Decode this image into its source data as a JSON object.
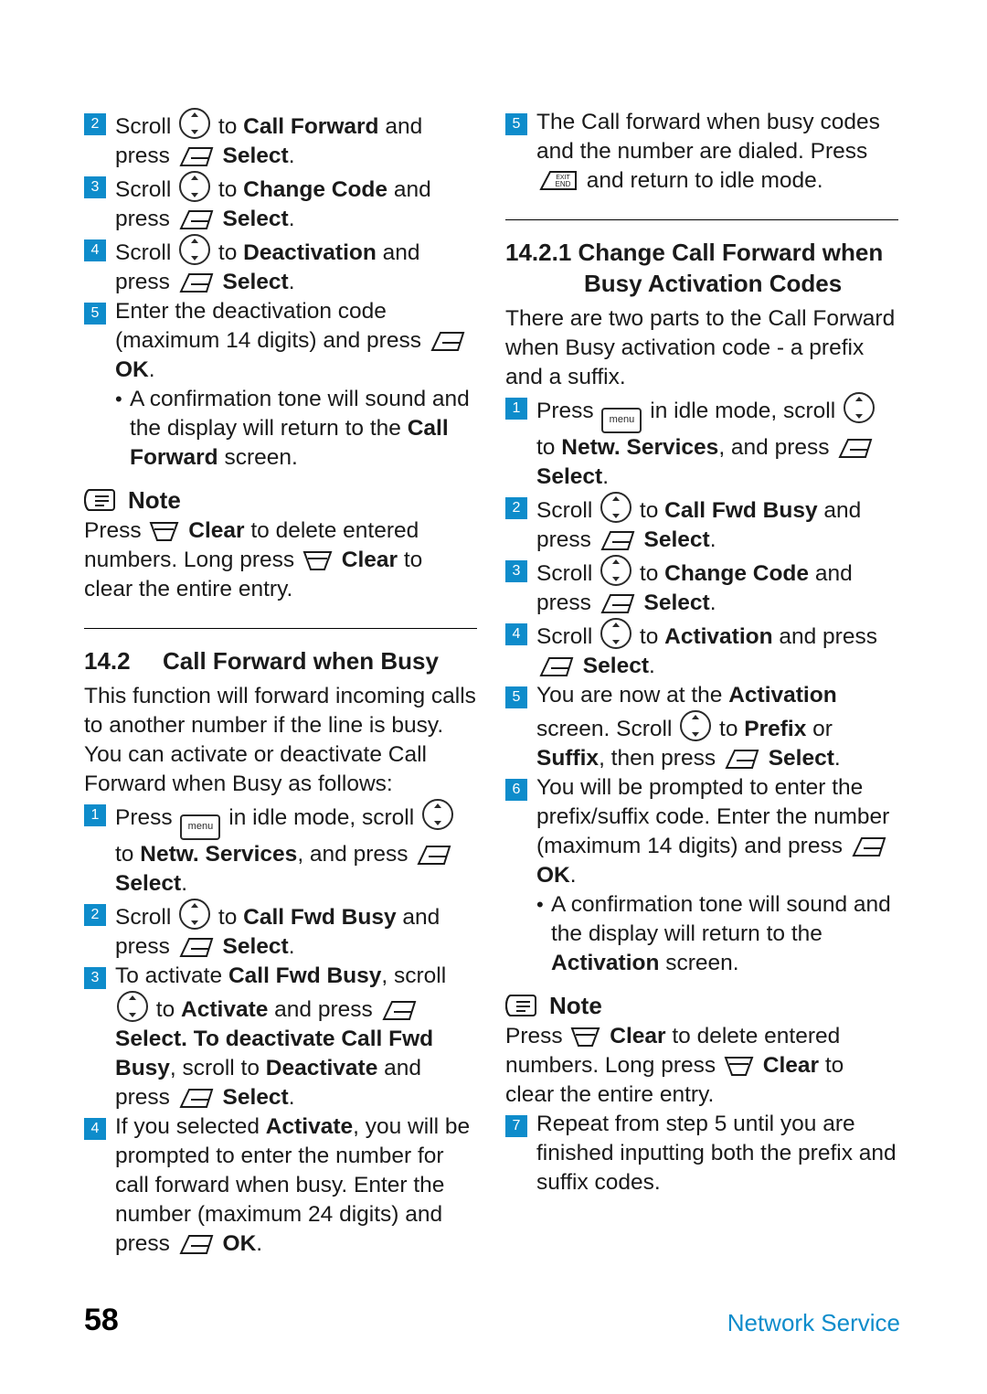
{
  "page": {
    "number": "58",
    "footer_right": "Network Service"
  },
  "icons": {
    "nav": "nav-scroll-key-icon",
    "soft": "soft-key-icon",
    "clear": "clear-key-icon",
    "menu": "menu-key-icon",
    "end": "exit-end-key-icon",
    "note": "note-icon",
    "menu_label": "menu",
    "end_label_top": "EXIT",
    "end_label_bottom": "END"
  },
  "colors": {
    "accent": "#0e8ccb",
    "step_badge": "#0e8ccb",
    "text": "#1a1a1a"
  },
  "left_column": {
    "steps": [
      {
        "num": "2",
        "parts": [
          {
            "t": "Scroll ",
            "w": "n"
          },
          {
            "icon": "nav"
          },
          {
            "t": " to ",
            "w": "n"
          },
          {
            "t": "Call Forward",
            "w": "b"
          },
          {
            "t": " and press ",
            "w": "n"
          },
          {
            "icon": "soft"
          },
          {
            "t": " Select",
            "w": "b"
          },
          {
            "t": ".",
            "w": "n"
          }
        ]
      },
      {
        "num": "3",
        "parts": [
          {
            "t": "Scroll ",
            "w": "n"
          },
          {
            "icon": "nav"
          },
          {
            "t": " to ",
            "w": "n"
          },
          {
            "t": "Change Code",
            "w": "b"
          },
          {
            "t": " and press ",
            "w": "n"
          },
          {
            "icon": "soft"
          },
          {
            "t": " Select",
            "w": "b"
          },
          {
            "t": ".",
            "w": "n"
          }
        ]
      },
      {
        "num": "4",
        "parts": [
          {
            "t": "Scroll ",
            "w": "n"
          },
          {
            "icon": "nav"
          },
          {
            "t": " to ",
            "w": "n"
          },
          {
            "t": "Deactivation",
            "w": "b"
          },
          {
            "t": " and press ",
            "w": "n"
          },
          {
            "icon": "soft"
          },
          {
            "t": " Select",
            "w": "b"
          },
          {
            "t": ".",
            "w": "n"
          }
        ]
      },
      {
        "num": "5",
        "parts": [
          {
            "t": "Enter the deactivation code (maximum 14 digits) and press ",
            "w": "n"
          },
          {
            "icon": "soft"
          },
          {
            "t": " OK",
            "w": "b"
          },
          {
            "t": ".",
            "w": "n"
          }
        ]
      }
    ],
    "bullet": [
      {
        "t": "A confirmation tone will sound and the display will return to the ",
        "w": "n"
      },
      {
        "t": "Call Forward",
        "w": "b"
      },
      {
        "t": " screen.",
        "w": "n"
      }
    ],
    "note": {
      "title": "Note",
      "parts": [
        {
          "t": "Press ",
          "w": "n"
        },
        {
          "icon": "clear"
        },
        {
          "t": " Clear",
          "w": "b"
        },
        {
          "t": " to delete entered numbers. Long press ",
          "w": "n"
        },
        {
          "icon": "clear"
        },
        {
          "t": " Clear",
          "w": "b"
        },
        {
          "t": " to clear the entire entry.",
          "w": "n"
        }
      ]
    },
    "section": {
      "number": "14.2",
      "title": "Call Forward when Busy",
      "intro": "This function will forward incoming calls to another number if the line is busy. You can activate or deactivate Call Forward when Busy as follows:"
    },
    "steps2": [
      {
        "num": "1",
        "parts": [
          {
            "t": "Press ",
            "w": "n"
          },
          {
            "icon": "menu"
          },
          {
            "t": " in idle mode, scroll ",
            "w": "n"
          },
          {
            "icon": "nav"
          },
          {
            "t": " to ",
            "w": "n"
          },
          {
            "t": "Netw. Services",
            "w": "b"
          },
          {
            "t": ", and press ",
            "w": "n"
          },
          {
            "icon": "soft"
          },
          {
            "t": " Select",
            "w": "b"
          },
          {
            "t": ".",
            "w": "n"
          }
        ]
      },
      {
        "num": "2",
        "parts": [
          {
            "t": "Scroll ",
            "w": "n"
          },
          {
            "icon": "nav"
          },
          {
            "t": " to ",
            "w": "n"
          },
          {
            "t": "Call Fwd Busy",
            "w": "b"
          },
          {
            "t": " and press ",
            "w": "n"
          },
          {
            "icon": "soft"
          },
          {
            "t": " Select",
            "w": "b"
          },
          {
            "t": ".",
            "w": "n"
          }
        ]
      },
      {
        "num": "3",
        "parts": [
          {
            "t": "To activate ",
            "w": "n"
          },
          {
            "t": "Call Fwd Busy",
            "w": "b"
          },
          {
            "t": ", scroll ",
            "w": "n"
          },
          {
            "icon": "nav"
          },
          {
            "t": " to ",
            "w": "n"
          },
          {
            "t": "Activate",
            "w": "b"
          },
          {
            "t": " and press ",
            "w": "n"
          },
          {
            "icon": "soft"
          },
          {
            "t": " Select. To deactivate Call Fwd Busy",
            "w": "b"
          },
          {
            "t": ", scroll to ",
            "w": "n"
          },
          {
            "t": "Deactivate",
            "w": "b"
          },
          {
            "t": " and press ",
            "w": "n"
          },
          {
            "icon": "soft"
          },
          {
            "t": " Select",
            "w": "b"
          },
          {
            "t": ".",
            "w": "n"
          }
        ]
      },
      {
        "num": "4",
        "parts": [
          {
            "t": "If you selected ",
            "w": "n"
          },
          {
            "t": "Activate",
            "w": "b"
          },
          {
            "t": ", you will be prompted to enter the number for call forward when busy. Enter the number (maximum 24 digits) and press ",
            "w": "n"
          },
          {
            "icon": "soft"
          },
          {
            "t": " OK",
            "w": "b"
          },
          {
            "t": ".",
            "w": "n"
          }
        ]
      }
    ]
  },
  "right_column": {
    "steps": [
      {
        "num": "5",
        "parts": [
          {
            "t": "The Call forward when busy codes and the number are dialed. Press ",
            "w": "n"
          },
          {
            "icon": "end"
          },
          {
            "t": " and return to idle mode.",
            "w": "n"
          }
        ]
      }
    ],
    "section": {
      "number": "14.2.1",
      "title_line1": "Change Call Forward when",
      "title_line2": "Busy Activation Codes",
      "intro": "There are two parts to the Call Forward when Busy activation code - a prefix and a suffix."
    },
    "steps2": [
      {
        "num": "1",
        "parts": [
          {
            "t": "Press ",
            "w": "n"
          },
          {
            "icon": "menu"
          },
          {
            "t": " in idle mode, scroll ",
            "w": "n"
          },
          {
            "icon": "nav"
          },
          {
            "t": " to ",
            "w": "n"
          },
          {
            "t": "Netw. Services",
            "w": "b"
          },
          {
            "t": ", and press ",
            "w": "n"
          },
          {
            "icon": "soft"
          },
          {
            "t": " Select",
            "w": "b"
          },
          {
            "t": ".",
            "w": "n"
          }
        ]
      },
      {
        "num": "2",
        "parts": [
          {
            "t": "Scroll ",
            "w": "n"
          },
          {
            "icon": "nav"
          },
          {
            "t": " to ",
            "w": "n"
          },
          {
            "t": "Call Fwd Busy",
            "w": "b"
          },
          {
            "t": " and press ",
            "w": "n"
          },
          {
            "icon": "soft"
          },
          {
            "t": " Select",
            "w": "b"
          },
          {
            "t": ".",
            "w": "n"
          }
        ]
      },
      {
        "num": "3",
        "parts": [
          {
            "t": "Scroll ",
            "w": "n"
          },
          {
            "icon": "nav"
          },
          {
            "t": " to ",
            "w": "n"
          },
          {
            "t": "Change Code",
            "w": "b"
          },
          {
            "t": " and press ",
            "w": "n"
          },
          {
            "icon": "soft"
          },
          {
            "t": " Select",
            "w": "b"
          },
          {
            "t": ".",
            "w": "n"
          }
        ]
      },
      {
        "num": "4",
        "parts": [
          {
            "t": "Scroll ",
            "w": "n"
          },
          {
            "icon": "nav"
          },
          {
            "t": " to ",
            "w": "n"
          },
          {
            "t": "Activation",
            "w": "b"
          },
          {
            "t": " and press ",
            "w": "n"
          },
          {
            "icon": "soft"
          },
          {
            "t": " Select",
            "w": "b"
          },
          {
            "t": ".",
            "w": "n"
          }
        ]
      },
      {
        "num": "5",
        "parts": [
          {
            "t": "You are now at the ",
            "w": "n"
          },
          {
            "t": "Activation",
            "w": "b"
          },
          {
            "t": " screen. Scroll ",
            "w": "n"
          },
          {
            "icon": "nav"
          },
          {
            "t": " to ",
            "w": "n"
          },
          {
            "t": "Prefix",
            "w": "b"
          },
          {
            "t": " or ",
            "w": "n"
          },
          {
            "t": "Suffix",
            "w": "b"
          },
          {
            "t": ", then press ",
            "w": "n"
          },
          {
            "icon": "soft"
          },
          {
            "t": " Select",
            "w": "b"
          },
          {
            "t": ".",
            "w": "n"
          }
        ]
      },
      {
        "num": "6",
        "parts": [
          {
            "t": "You will be prompted to enter the prefix/suffix code. Enter the number (maximum 14 digits) and press ",
            "w": "n"
          },
          {
            "icon": "soft"
          },
          {
            "t": " OK",
            "w": "b"
          },
          {
            "t": ".",
            "w": "n"
          }
        ]
      }
    ],
    "bullet": [
      {
        "t": "A confirmation tone will sound and the display will return to the ",
        "w": "n"
      },
      {
        "t": "Activation",
        "w": "b"
      },
      {
        "t": " screen.",
        "w": "n"
      }
    ],
    "note": {
      "title": "Note",
      "parts": [
        {
          "t": "Press ",
          "w": "n"
        },
        {
          "icon": "clear"
        },
        {
          "t": " Clear",
          "w": "b"
        },
        {
          "t": " to delete entered numbers. Long press ",
          "w": "n"
        },
        {
          "icon": "clear"
        },
        {
          "t": " Clear",
          "w": "b"
        },
        {
          "t": " to clear the entire entry.",
          "w": "n"
        }
      ]
    },
    "steps3": [
      {
        "num": "7",
        "parts": [
          {
            "t": "Repeat from step 5 until you are finished inputting both the prefix and suffix codes.",
            "w": "n"
          }
        ]
      }
    ]
  }
}
